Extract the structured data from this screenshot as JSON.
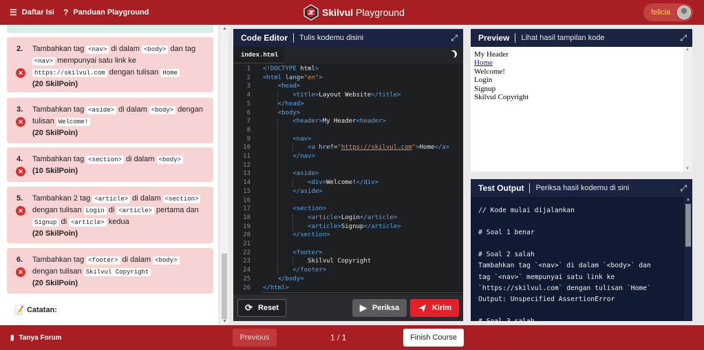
{
  "topbar": {
    "toc_label": "Daftar Isi",
    "guide_label": "Panduan Playground",
    "brand_bold": "Skilvul",
    "brand_rest": " Playground",
    "user_name": "felicia"
  },
  "tasks": [
    {
      "num": "2.",
      "parts": [
        "Tambahkan tag ",
        "<nav>",
        " di dalam ",
        "<body>",
        " dan tag ",
        "<nav>",
        " mempunyai satu link ke ",
        "https://skilvul.com",
        " dengan tulisan ",
        "Home"
      ],
      "points": "(20 SkilPoin)"
    },
    {
      "num": "3.",
      "parts": [
        "Tambahkan tag ",
        "<aside>",
        " di dalam ",
        "<body>",
        " dengan tulisan ",
        "Welcome!"
      ],
      "points": "(20 SkilPoin)"
    },
    {
      "num": "4.",
      "parts": [
        "Tambahkan tag ",
        "<section>",
        " di dalam ",
        "<body>"
      ],
      "points": "(10 SkilPoin)"
    },
    {
      "num": "5.",
      "parts": [
        "Tambahkan 2 tag ",
        "<article>",
        " di dalam ",
        "<section>",
        " dengan tulisan ",
        "Login",
        " di ",
        "<article>",
        " pertama dan ",
        "Signup",
        " di ",
        "<article>",
        " kedua"
      ],
      "points": "(20 SkilPoin)"
    },
    {
      "num": "6.",
      "parts": [
        "Tambahkan tag ",
        "<footer>",
        " di dalam ",
        "<body>",
        " dengan tulisan ",
        "Skilvul Copyright"
      ],
      "points": "(20 SkilPoin)"
    }
  ],
  "notes": {
    "title": "Catatan:"
  },
  "editor": {
    "title": "Code Editor",
    "subtitle": "Tulis kodemu disini",
    "tab": "index.html",
    "code": [
      "<!DOCTYPE html>",
      "<html lang=\"en\">",
      "    <head>",
      "        <title>Layout Website</title>",
      "    </head>",
      "    <body>",
      "        <header>My Header<header>",
      "",
      "        <nav>",
      "            <a href=\"https://skilvul.com\">Home</a>",
      "        </nav>",
      "",
      "        <aside>",
      "            <div>Welcome!</div>",
      "        </aside>",
      "",
      "        <section>",
      "            <article>Login</article>",
      "            <article>Signup</article>",
      "        </section>",
      "",
      "        <footer>",
      "            Skilvul Copyright",
      "        </footer>",
      "    </body>",
      "</html>"
    ],
    "reset_label": "Reset",
    "check_label": "Periksa",
    "submit_label": "Kirim"
  },
  "preview": {
    "title": "Preview",
    "subtitle": "Lihat hasil tampilan kode",
    "lines": [
      "My Header",
      "Home",
      "Welcome!",
      "Login",
      "Signup",
      "Skilvul Copyright"
    ]
  },
  "output": {
    "title": "Test Output",
    "subtitle": "Periksa hasil kodemu di sini",
    "text": "// Kode mulai dijalankan\n\n# Soal 1 benar\n\n# Soal 2 salah\nTambahkan tag `<nav>` di dalam `<body>` dan\ntag `<nav>` mempunyai satu link ke\n`https://skilvul.com` dengan tulisan `Home`\nOutput: Unspecified AssertionError\n\n# Soal 3 salah"
  },
  "bottombar": {
    "forum_label": "Tanya Forum",
    "prev_label": "Previous",
    "pager": "1 / 1",
    "finish_label": "Finish Course"
  },
  "colors": {
    "brand": "#a91e22",
    "navy": "#1a2340",
    "error": "#d8302f",
    "task_bg": "#f7d3d3"
  }
}
